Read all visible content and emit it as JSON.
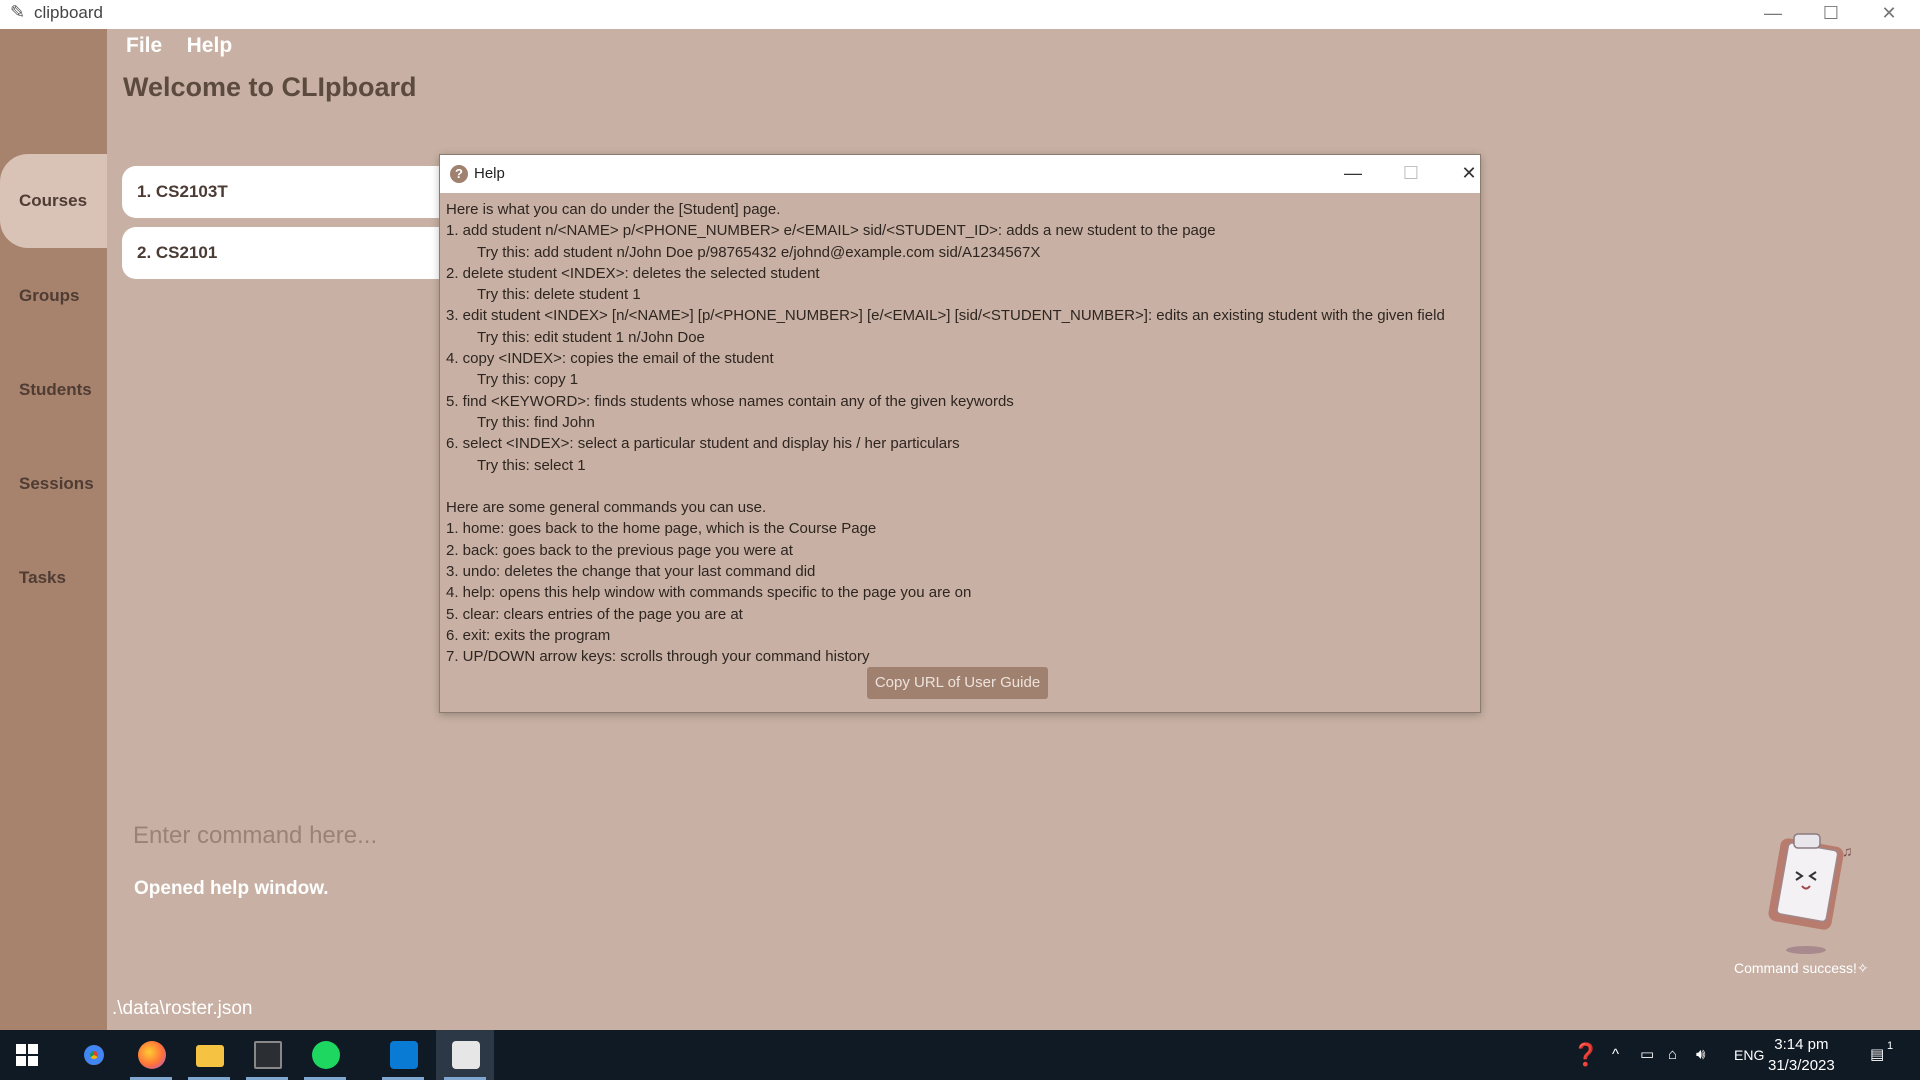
{
  "window": {
    "title": "clipboard",
    "minimize": "—",
    "maximize": "☐",
    "close": "✕"
  },
  "menu": {
    "file": "File",
    "help": "Help"
  },
  "welcome": "Welcome to CLIpboard",
  "sidebar": {
    "items": [
      {
        "label": "Courses"
      },
      {
        "label": "Groups"
      },
      {
        "label": "Students"
      },
      {
        "label": "Sessions"
      },
      {
        "label": "Tasks"
      }
    ]
  },
  "courses": [
    {
      "label": "1.  CS2103T"
    },
    {
      "label": "2.  CS2101"
    }
  ],
  "command": {
    "placeholder": "Enter command here..."
  },
  "result": "Opened help window.",
  "status": {
    "filepath": ".\\data\\roster.json",
    "mascot_caption": "Command success!✧"
  },
  "help_window": {
    "title": "Help",
    "lines": [
      "Here is what you can do under the [Student] page.",
      "1. add student n/<NAME> p/<PHONE_NUMBER> e/<EMAIL> sid/<STUDENT_ID>: adds a new student to the page",
      "Try this: add student n/John Doe p/98765432 e/johnd@example.com sid/A1234567X",
      "2. delete student <INDEX>: deletes the selected student",
      "Try this: delete student 1",
      "3. edit student <INDEX> [n/<NAME>] [p/<PHONE_NUMBER>] [e/<EMAIL>] [sid/<STUDENT_NUMBER>]: edits an existing student with the given field",
      "Try this: edit student 1 n/John Doe",
      "4. copy <INDEX>: copies the email of the student",
      "Try this: copy 1",
      "5. find <KEYWORD>: finds students whose names contain any of the given keywords",
      "Try this: find John",
      "6. select <INDEX>: select a particular student and display his / her particulars",
      "Try this: select 1",
      "",
      "Here are some general commands you can use.",
      "1. home: goes back to the home page, which is the Course Page",
      "2. back: goes back to the previous page you were at",
      "3. undo: deletes the change that your last command did",
      "4. help: opens this help window with commands specific to the page you are on",
      "5. clear: clears entries of the page you are at",
      "6. exit: exits the program",
      "7. UP/DOWN arrow keys: scrolls through your command history"
    ],
    "copy_button": "Copy URL of User Guide"
  },
  "taskbar": {
    "apps": [
      "chrome-icon",
      "firefox-icon",
      "file-explorer-icon",
      "terminal-icon",
      "spotify-icon",
      "vscode-icon",
      "clipboard-app-icon"
    ],
    "language": "ENG",
    "time": "3:14 pm",
    "date": "31/3/2023",
    "notification_count": "1"
  }
}
